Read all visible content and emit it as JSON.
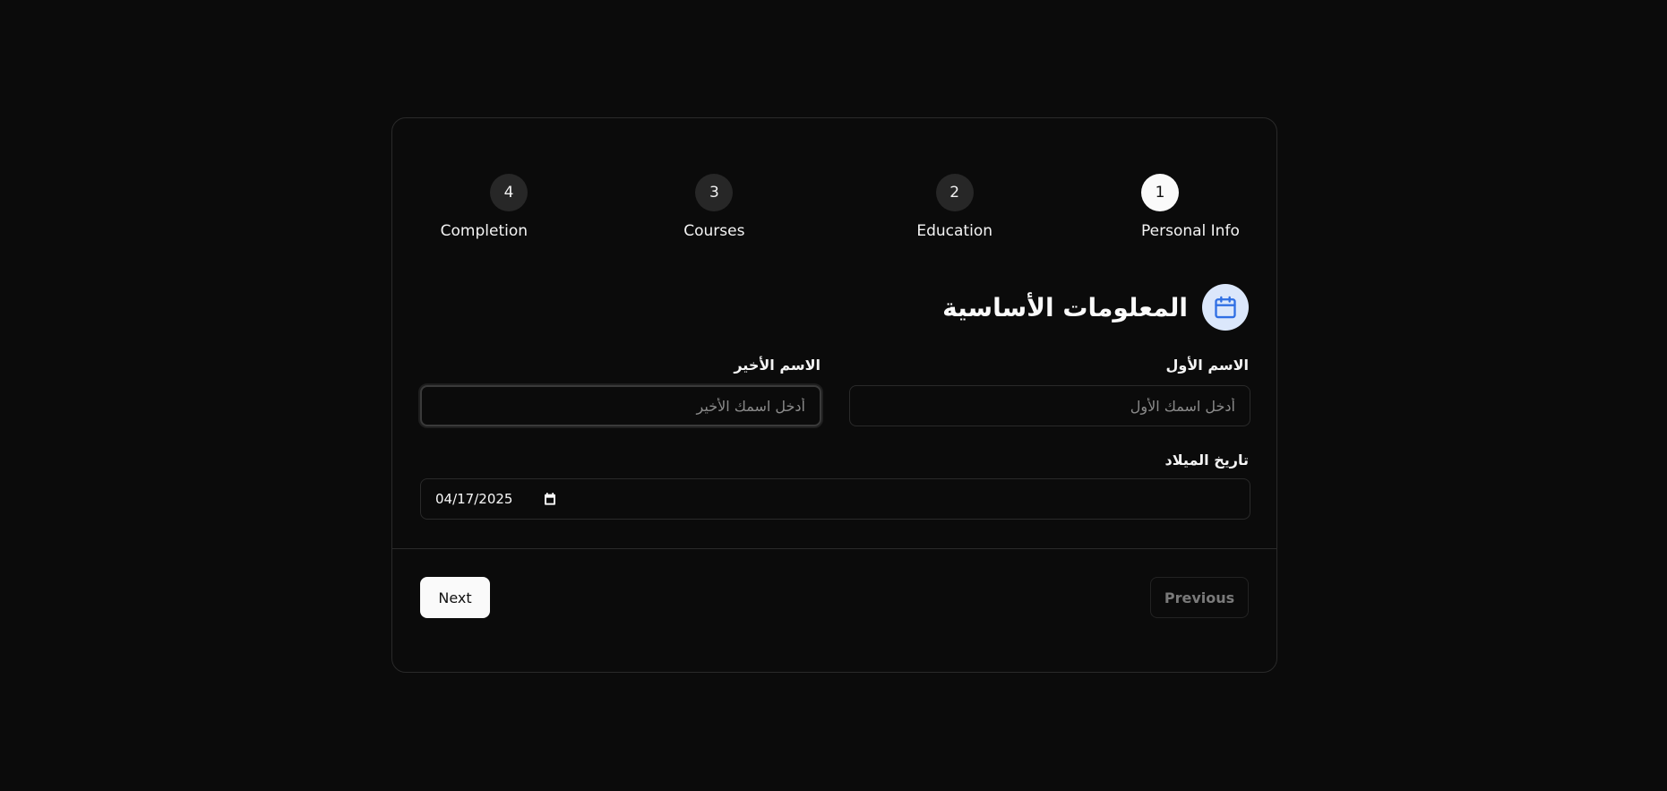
{
  "stepper": {
    "steps": [
      {
        "number": "1",
        "label": "Personal Info",
        "active": true
      },
      {
        "number": "2",
        "label": "Education",
        "active": false
      },
      {
        "number": "3",
        "label": "Courses",
        "active": false
      },
      {
        "number": "4",
        "label": "Completion",
        "active": false
      }
    ]
  },
  "section": {
    "title": "المعلومات الأساسية",
    "icon": "calendar-icon",
    "icon_color": "#2f6fe4",
    "icon_bg": "#dbe7fb"
  },
  "form": {
    "first_name": {
      "label": "الاسم الأول",
      "placeholder": "أدخل اسمك الأول",
      "value": ""
    },
    "last_name": {
      "label": "الاسم الأخير",
      "placeholder": "أدخل اسمك الأخير",
      "value": ""
    },
    "birth_date": {
      "label": "تاريخ الميلاد",
      "value": "04/17/2025",
      "icon": "calendar-icon"
    }
  },
  "actions": {
    "next_label": "Next",
    "previous_label": "Previous"
  },
  "colors": {
    "background": "#0b0b0b",
    "border": "#2a2a2a",
    "active_step": "#fafafa",
    "inactive_step": "#272727"
  }
}
